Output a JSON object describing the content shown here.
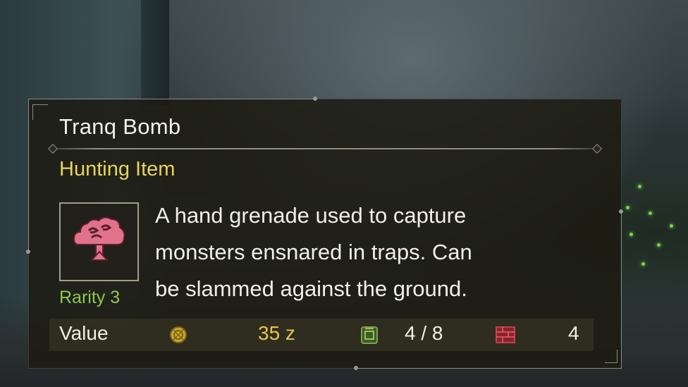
{
  "item": {
    "name": "Tranq Bomb",
    "category": "Hunting Item",
    "rarity": "Rarity 3",
    "icon": "tranq-bomb-icon",
    "description_lines": [
      "A hand grenade used to capture",
      "monsters ensnared in traps. Can",
      "be slammed against the ground."
    ]
  },
  "stats": {
    "value_label": "Value",
    "value_icon": "zenny-coin-icon",
    "value": "35 z",
    "carry_icon": "item-pouch-icon",
    "carry": "4 / 8",
    "box_icon": "item-box-icon",
    "box_count": "4"
  },
  "colors": {
    "title": "#f3f1ea",
    "category": "#e8d35c",
    "rarity": "#8fc84a",
    "zenny": "#e7c54e",
    "icon_pink": "#e0738a"
  }
}
